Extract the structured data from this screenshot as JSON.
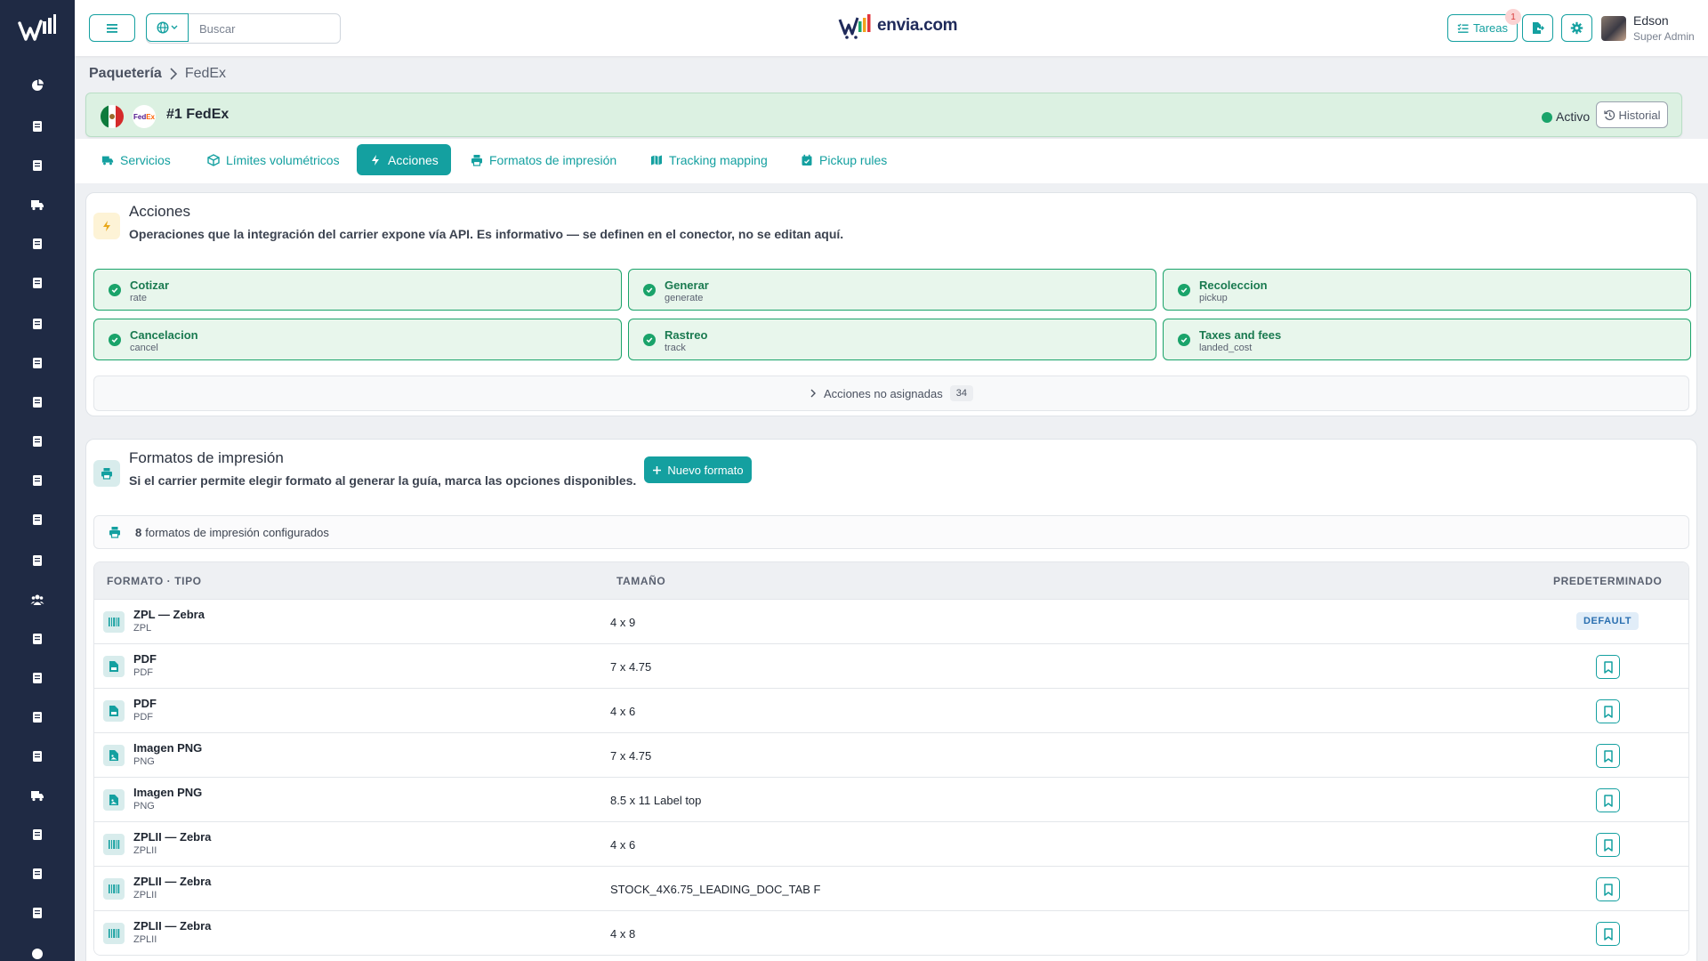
{
  "header": {
    "search_placeholder": "Buscar",
    "logo_text": "envia.com",
    "tareas_label": "Tareas",
    "notification_count": "1",
    "user_name": "Edson",
    "user_role": "Super Admin"
  },
  "breadcrumb": {
    "root": "Paquetería",
    "current": "FedEx"
  },
  "carrier": {
    "title": "#1 FedEx",
    "fedex_logo": "FedEx",
    "status": "Activo",
    "history_label": "Historial"
  },
  "tabs": [
    {
      "label": "Servicios",
      "icon": "truck-icon"
    },
    {
      "label": "Límites volumétricos",
      "icon": "box-icon"
    },
    {
      "label": "Acciones",
      "icon": "bolt-icon"
    },
    {
      "label": "Formatos de impresión",
      "icon": "printer-icon"
    },
    {
      "label": "Tracking mapping",
      "icon": "map-icon"
    },
    {
      "label": "Pickup rules",
      "icon": "calendar-icon"
    }
  ],
  "actions_card": {
    "title": "Acciones",
    "subtitle": "Operaciones que la integración del carrier expone vía API. Es informativo — se definen en el conector, no se editan aquí.",
    "items": [
      {
        "name": "Cotizar",
        "code": "rate"
      },
      {
        "name": "Generar",
        "code": "generate"
      },
      {
        "name": "Recoleccion",
        "code": "pickup"
      },
      {
        "name": "Cancelacion",
        "code": "cancel"
      },
      {
        "name": "Rastreo",
        "code": "track"
      },
      {
        "name": "Taxes and fees",
        "code": "landed_cost"
      }
    ],
    "unassigned_label": "Acciones no asignadas",
    "unassigned_count": "34"
  },
  "formats_card": {
    "title": "Formatos de impresión",
    "subtitle": "Si el carrier permite elegir formato al generar la guía, marca las opciones disponibles.",
    "new_button": "Nuevo formato",
    "count": "8",
    "count_suffix": "formatos de impresión configurados",
    "columns": [
      "FORMATO · TIPO",
      "TAMAÑO",
      "PREDETERMINADO"
    ],
    "default_label": "DEFAULT",
    "rows": [
      {
        "name": "ZPL — Zebra",
        "type": "ZPL",
        "size": "4 x 9",
        "default": true,
        "icon": "barcode-icon"
      },
      {
        "name": "PDF",
        "type": "PDF",
        "size": "7 x 4.75",
        "default": false,
        "icon": "pdf-icon"
      },
      {
        "name": "PDF",
        "type": "PDF",
        "size": "4 x 6",
        "default": false,
        "icon": "pdf-icon"
      },
      {
        "name": "Imagen PNG",
        "type": "PNG",
        "size": "7 x 4.75",
        "default": false,
        "icon": "image-file-icon"
      },
      {
        "name": "Imagen PNG",
        "type": "PNG",
        "size": "8.5 x 11 Label top",
        "default": false,
        "icon": "image-file-icon"
      },
      {
        "name": "ZPLII — Zebra",
        "type": "ZPLII",
        "size": "4 x 6",
        "default": false,
        "icon": "barcode-icon"
      },
      {
        "name": "ZPLII — Zebra",
        "type": "ZPLII",
        "size": "STOCK_4X6.75_LEADING_DOC_TAB F",
        "default": false,
        "icon": "barcode-icon"
      },
      {
        "name": "ZPLII — Zebra",
        "type": "ZPLII",
        "size": "4 x 8",
        "default": false,
        "icon": "barcode-icon"
      }
    ]
  },
  "colors": {
    "accent": "#14a0a0",
    "success": "#1aa36a",
    "sidebar": "#1f2a44"
  }
}
